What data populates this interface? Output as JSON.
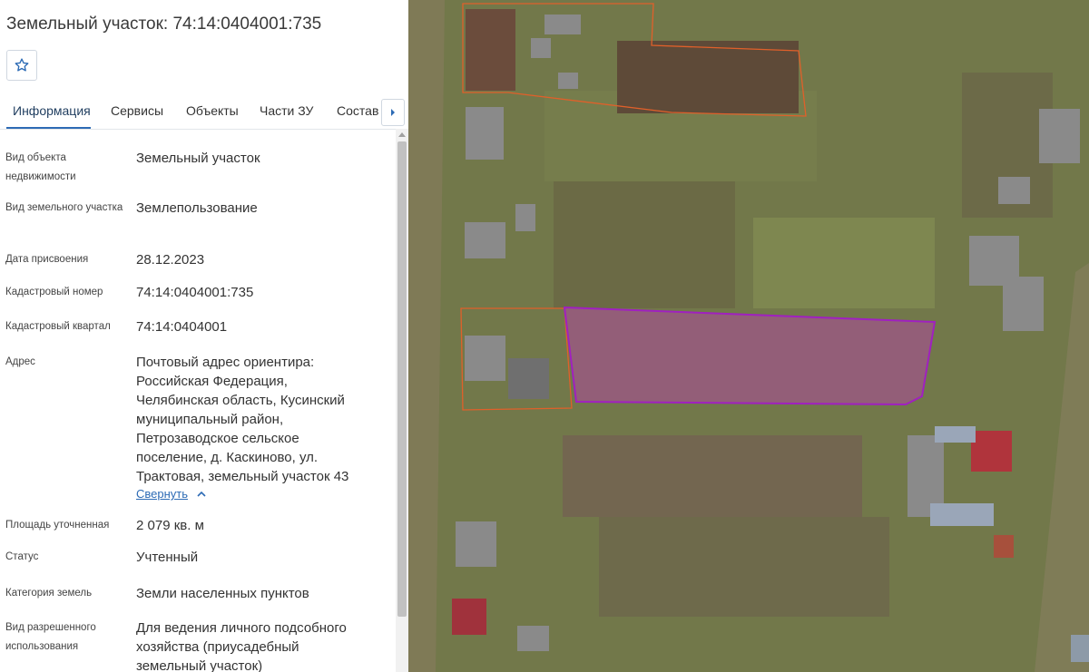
{
  "title": "Земельный участок: 74:14:0404001:735",
  "favorite": {
    "icon": "star-outline-icon"
  },
  "tabs": [
    {
      "label": "Информация",
      "active": true
    },
    {
      "label": "Сервисы",
      "active": false
    },
    {
      "label": "Объекты",
      "active": false
    },
    {
      "label": "Части ЗУ",
      "active": false
    },
    {
      "label": "Состав",
      "active": false
    }
  ],
  "tab_scroll_icon": "chevron-right-icon",
  "fields": [
    {
      "label": "Вид объекта недвижимости",
      "value": "Земельный участок"
    },
    {
      "label": "Вид земельного участка",
      "value": "Землепользование"
    },
    {
      "label": "Дата присвоения",
      "value": "28.12.2023"
    },
    {
      "label": "Кадастровый номер",
      "value": "74:14:0404001:735"
    },
    {
      "label": "Кадастровый квартал",
      "value": "74:14:0404001"
    },
    {
      "label": "Адрес",
      "value": "Почтовый адрес ориентира: Российская Федерация, Челябинская область, Кусинский муниципальный район, Петрозаводское сельское поселение, д. Каскиново, ул. Трактовая, земельный участок 43"
    },
    {
      "label": "Площадь уточненная",
      "value": "2 079 кв. м"
    },
    {
      "label": "Статус",
      "value": "Учтенный"
    },
    {
      "label": "Категория земель",
      "value": "Земли населенных пунктов"
    },
    {
      "label": "Вид разрешенного использования",
      "value": "Для ведения личного подсобного хозяйства (приусадебный земельный участок)"
    }
  ],
  "address_collapse_label": "Свернуть",
  "colors": {
    "accent": "#2d6bb5",
    "selected_parcel_fill": "#c23cb8",
    "selected_parcel_stroke": "#a020c0",
    "neighbor_parcel_stroke": "#e0602a"
  }
}
